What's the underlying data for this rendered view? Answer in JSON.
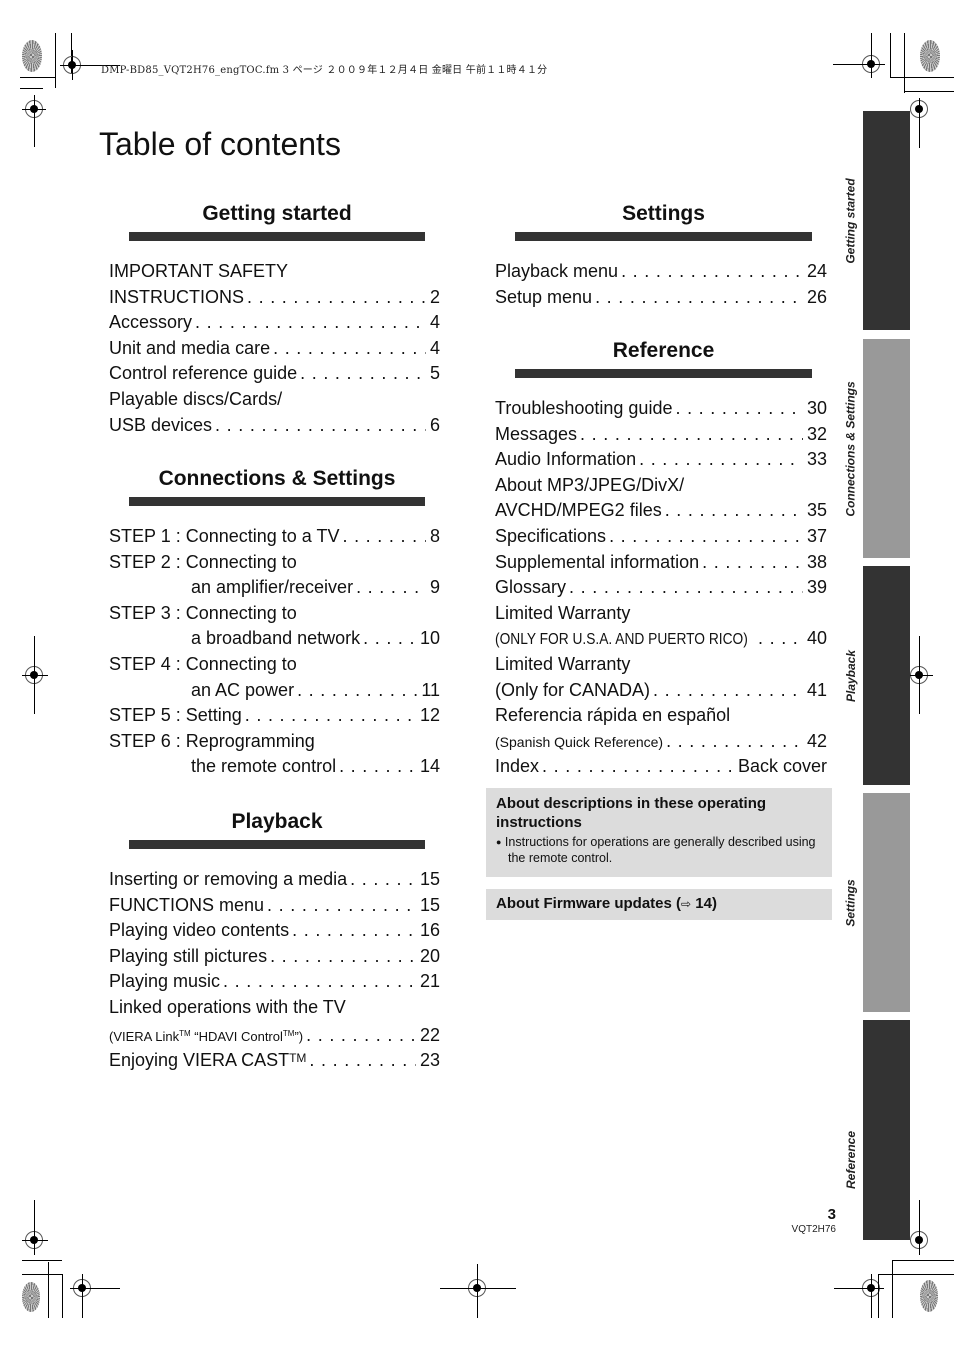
{
  "print_header": "DMP-BD85_VQT2H76_engTOC.fm  3 ページ  ２００９年１２月４日  金曜日  午前１１時４１分",
  "title": "Table of contents",
  "sections": {
    "getting_started": {
      "title": "Getting started",
      "entries": [
        {
          "label": "IMPORTANT SAFETY",
          "page": ""
        },
        {
          "label": "INSTRUCTIONS",
          "page": "2"
        },
        {
          "label": "Accessory",
          "page": "4"
        },
        {
          "label": "Unit and media care",
          "page": "4"
        },
        {
          "label": "Control reference guide",
          "page": "5"
        },
        {
          "label": "Playable discs/Cards/",
          "page": ""
        },
        {
          "label": "USB devices",
          "page": "6"
        }
      ]
    },
    "connections": {
      "title": "Connections & Settings",
      "entries": [
        {
          "label": "STEP 1 : Connecting to a TV",
          "page": "8"
        },
        {
          "label": "STEP 2 : Connecting to",
          "page": ""
        },
        {
          "label": "an amplifier/receiver",
          "page": "9"
        },
        {
          "label": "STEP 3 : Connecting to",
          "page": ""
        },
        {
          "label": "a broadband network",
          "page": "10"
        },
        {
          "label": "STEP 4 : Connecting to",
          "page": ""
        },
        {
          "label": "an AC power",
          "page": "11"
        },
        {
          "label": "STEP 5 : Setting",
          "page": "12"
        },
        {
          "label": "STEP 6 : Reprogramming",
          "page": ""
        },
        {
          "label": "the remote control",
          "page": "14"
        }
      ]
    },
    "playback": {
      "title": "Playback",
      "entries": [
        {
          "label": "Inserting or removing a media",
          "page": "15"
        },
        {
          "label": "FUNCTIONS menu",
          "page": "15"
        },
        {
          "label": "Playing video contents",
          "page": "16"
        },
        {
          "label": "Playing still pictures",
          "page": "20"
        },
        {
          "label": "Playing music",
          "page": "21"
        },
        {
          "label": "Linked operations with the TV",
          "page": ""
        },
        {
          "label": "(VIERA Link",
          "tm1": "TM",
          "label_mid": " “HDAVI Control",
          "tm2": "TM",
          "label_end": "”)",
          "page": "22"
        },
        {
          "label": "Enjoying VIERA CAST",
          "tm": "TM",
          "page": "23"
        }
      ]
    },
    "settings": {
      "title": "Settings",
      "entries": [
        {
          "label": "Playback menu",
          "page": "24"
        },
        {
          "label": "Setup menu",
          "page": "26"
        }
      ]
    },
    "reference": {
      "title": "Reference",
      "entries": [
        {
          "label": "Troubleshooting guide",
          "page": "30"
        },
        {
          "label": "Messages",
          "page": "32"
        },
        {
          "label": "Audio Information",
          "page": "33"
        },
        {
          "label": "About MP3/JPEG/DivX/",
          "page": ""
        },
        {
          "label": "AVCHD/MPEG2 files",
          "page": "35"
        },
        {
          "label": "Specifications",
          "page": "37"
        },
        {
          "label": "Supplemental information",
          "page": "38"
        },
        {
          "label": "Glossary",
          "page": "39"
        },
        {
          "label": "Limited Warranty",
          "page": ""
        },
        {
          "label": "(ONLY FOR U.S.A. AND PUERTO RICO)",
          "page": "40"
        },
        {
          "label": "Limited Warranty",
          "page": ""
        },
        {
          "label": "(Only for CANADA)",
          "page": "41"
        },
        {
          "label": "Referencia rápida en español",
          "page": ""
        },
        {
          "label": "(Spanish Quick Reference)",
          "page": "42"
        },
        {
          "label": "Index",
          "page": "Back cover"
        }
      ]
    }
  },
  "notes": {
    "descriptions": {
      "title": "About descriptions in these operating instructions",
      "bullet": "●",
      "text": "Instructions for operations are generally described using the remote control."
    },
    "firmware": {
      "title_prefix": "About Firmware updates (",
      "arrow": "⇨",
      "page": " 14",
      "title_suffix": ")"
    }
  },
  "side_tabs": [
    {
      "label": "Getting started",
      "color": "#333333"
    },
    {
      "label": "Connections & Settings",
      "color": "#999999"
    },
    {
      "label": "Playback",
      "color": "#333333"
    },
    {
      "label": "Settings",
      "color": "#999999"
    },
    {
      "label": "Reference",
      "color": "#333333"
    }
  ],
  "footer": {
    "page_number": "3",
    "doc_code": "VQT2H76"
  }
}
